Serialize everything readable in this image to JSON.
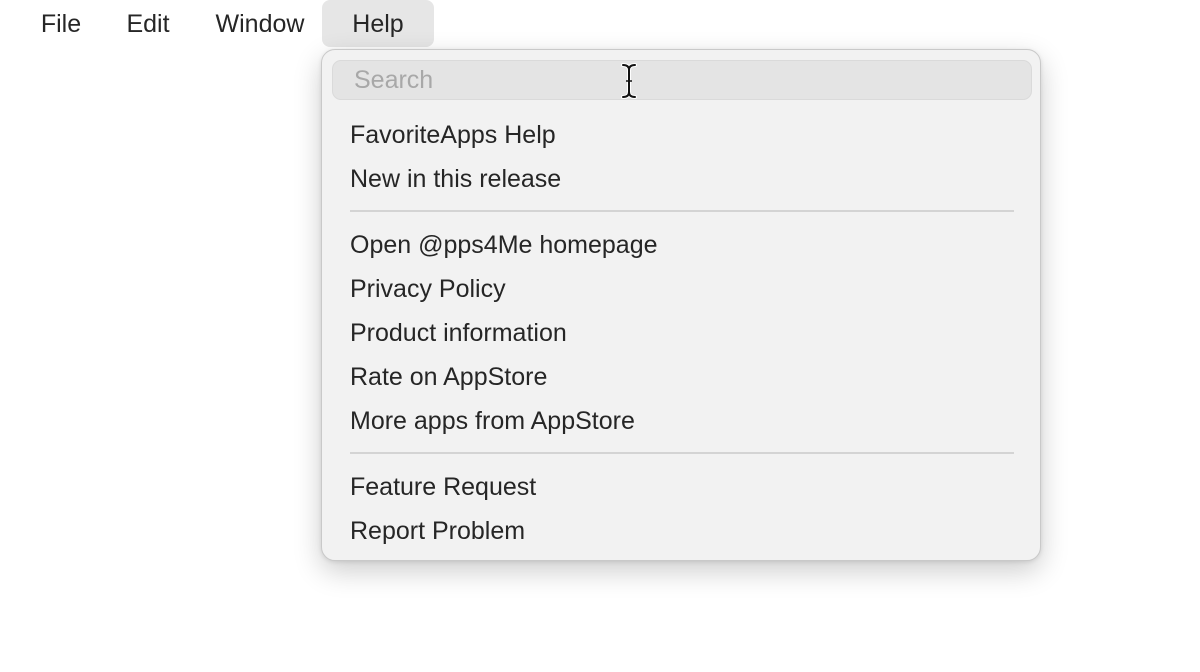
{
  "menubar": {
    "items": [
      {
        "label": "File"
      },
      {
        "label": "Edit"
      },
      {
        "label": "Window"
      },
      {
        "label": "Help"
      }
    ],
    "active": "Help"
  },
  "help_menu": {
    "search": {
      "placeholder": "Search",
      "value": ""
    },
    "groups": [
      [
        "FavoriteApps Help",
        "New in this release"
      ],
      [
        "Open @pps4Me homepage",
        "Privacy Policy",
        "Product information",
        "Rate on AppStore",
        "More apps from AppStore"
      ],
      [
        "Feature Request",
        "Report Problem"
      ]
    ]
  },
  "cursor": {
    "icon": "text-cursor-icon"
  },
  "colors": {
    "menu_background": "#f2f2f2",
    "active_menubar_item": "#e6e6e6",
    "text": "#262626",
    "placeholder": "#a8a8a8",
    "separator": "#d4d4d4"
  }
}
